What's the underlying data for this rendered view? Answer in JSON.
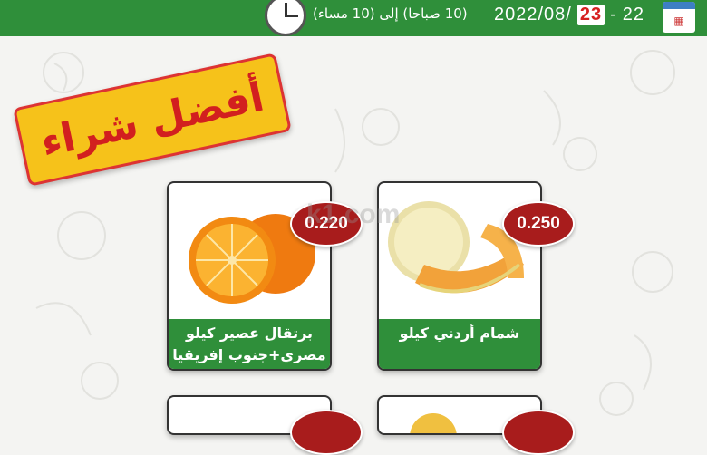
{
  "header": {
    "calendar_icon": "calendar-icon",
    "date_day_start": "22",
    "date_dash": "-",
    "date_day_end": "23",
    "date_rest": "2022/08/",
    "time_text": "(10 صباحا) إلى (10 مساء)",
    "clock_icon": "clock-icon"
  },
  "banner": {
    "label": "أفضل شراء"
  },
  "watermark": "k1.com",
  "products": [
    {
      "name": "برتقال عصير كيلو مصري+جنوب إفريقيا",
      "price": "0.220",
      "image": "orange-image"
    },
    {
      "name": "شمام أردني كيلو",
      "price": "0.250",
      "image": "melon-image"
    }
  ],
  "colors": {
    "green": "#2f8f3a",
    "red": "#a81c1c",
    "yellow": "#f6c21a"
  }
}
